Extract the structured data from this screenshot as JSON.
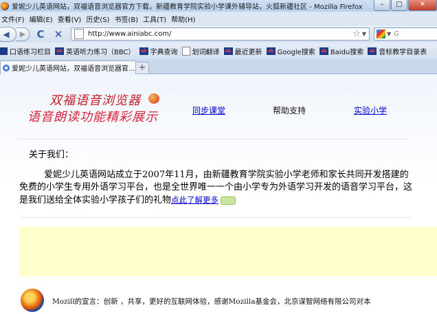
{
  "window": {
    "title": "爱妮少儿英语网站，双福语音浏览器官方下载，新疆教育学院实验小学课外辅导站，火狐新疆社区 - Mozilla Firefox",
    "minimize": "–",
    "maximize": "□",
    "close": "✕"
  },
  "menubar": [
    "文件(F)",
    "编辑(E)",
    "查看(V)",
    "历史(S)",
    "书签(B)",
    "工具(T)",
    "帮助(H)"
  ],
  "navbar": {
    "back": "◀",
    "forward": "▶",
    "reload": "C",
    "stop": "✕",
    "url": "http://www.ainiabc.com/",
    "star": "☆",
    "dropdown": "▼",
    "search_placeholder": "G"
  },
  "bookmarks": [
    {
      "label": "口语练习栏目",
      "icon": "site-icon",
      "icon_text": ""
    },
    {
      "label": "英语听力练习（BBC）",
      "icon": "site-icon",
      "icon_text": "ab"
    },
    {
      "label": "字典查询",
      "icon": "site-icon",
      "icon_text": "ab"
    },
    {
      "label": "划词翻译",
      "icon": "page-icon",
      "icon_text": ""
    },
    {
      "label": "最近更新",
      "icon": "site-icon",
      "icon_text": "ab"
    },
    {
      "label": "Google搜索",
      "icon": "site-icon",
      "icon_text": "ab"
    },
    {
      "label": "Baidu搜索",
      "icon": "site-icon",
      "icon_text": "ab"
    },
    {
      "label": "音标教学目录表",
      "icon": "site-icon",
      "icon_text": "ab"
    }
  ],
  "tabs": [
    {
      "label": "爱妮少儿英语网站，双福语音浏览器官..."
    }
  ],
  "new_tab": "+",
  "page": {
    "logo_line1": "双福语音浏览器",
    "logo_line2": "语音朗读功能精彩展示",
    "nav": [
      "同步课堂",
      "帮助支持",
      "实验小学"
    ],
    "about_title": "关于我们：",
    "about_text": "爱妮少儿英语网站成立于2007年11月，由新疆教育学院实验小学老师和家长共同开发搭建的免费的小学生专用外语学习平台，也是全世界唯一一个由小学专为外语学习开发的语音学习平台，这是我们送给全体实验小学孩子们的礼物",
    "about_link": "点此了解更多",
    "footer_text": "Mozill的宣言：创新 ，共享，更好的互联网体验，感谢Mozilla基金会，北京谋智网络有限公司对本"
  },
  "colors": {
    "link": "#0000cc",
    "logo_red": "#c0202a",
    "banner_yellow": "#ffffcc"
  }
}
